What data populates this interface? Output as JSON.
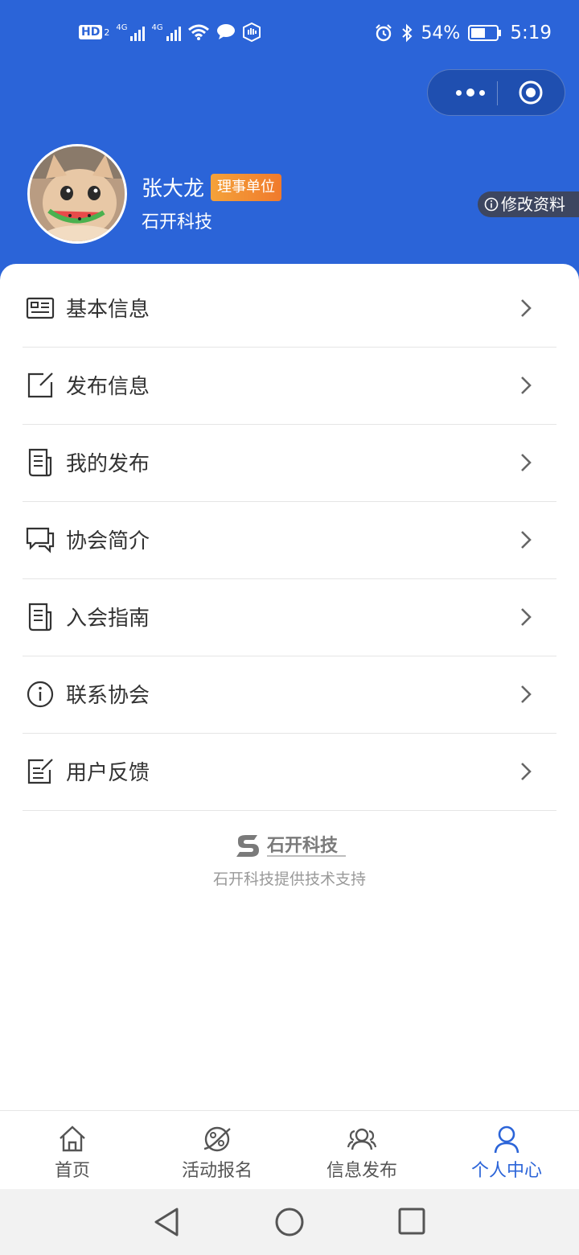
{
  "status_bar": {
    "hd": "HD",
    "hd_sub": "2",
    "net1": "4G",
    "net2": "4G",
    "battery_percent": "54%",
    "time": "5:19"
  },
  "profile": {
    "name": "张大龙",
    "role_badge": "理事单位",
    "company": "石开科技",
    "edit_label": "修改资料"
  },
  "menu": {
    "items": [
      {
        "label": "基本信息",
        "icon": "id-card-icon"
      },
      {
        "label": "发布信息",
        "icon": "edit-icon"
      },
      {
        "label": "我的发布",
        "icon": "document-icon"
      },
      {
        "label": "协会简介",
        "icon": "chat-bubbles-icon"
      },
      {
        "label": "入会指南",
        "icon": "document-icon"
      },
      {
        "label": "联系协会",
        "icon": "info-icon"
      },
      {
        "label": "用户反馈",
        "icon": "feedback-icon"
      }
    ]
  },
  "footer": {
    "support_text": "石开科技提供技术支持"
  },
  "tabbar": {
    "tabs": [
      {
        "label": "首页",
        "icon": "home-icon"
      },
      {
        "label": "活动报名",
        "icon": "planet-icon"
      },
      {
        "label": "信息发布",
        "icon": "users-icon"
      },
      {
        "label": "个人中心",
        "icon": "user-icon",
        "active": true
      }
    ]
  },
  "colors": {
    "header_blue": "#2b64d8",
    "active_tab": "#2b64d8",
    "badge_orange": "#f07a2c"
  }
}
